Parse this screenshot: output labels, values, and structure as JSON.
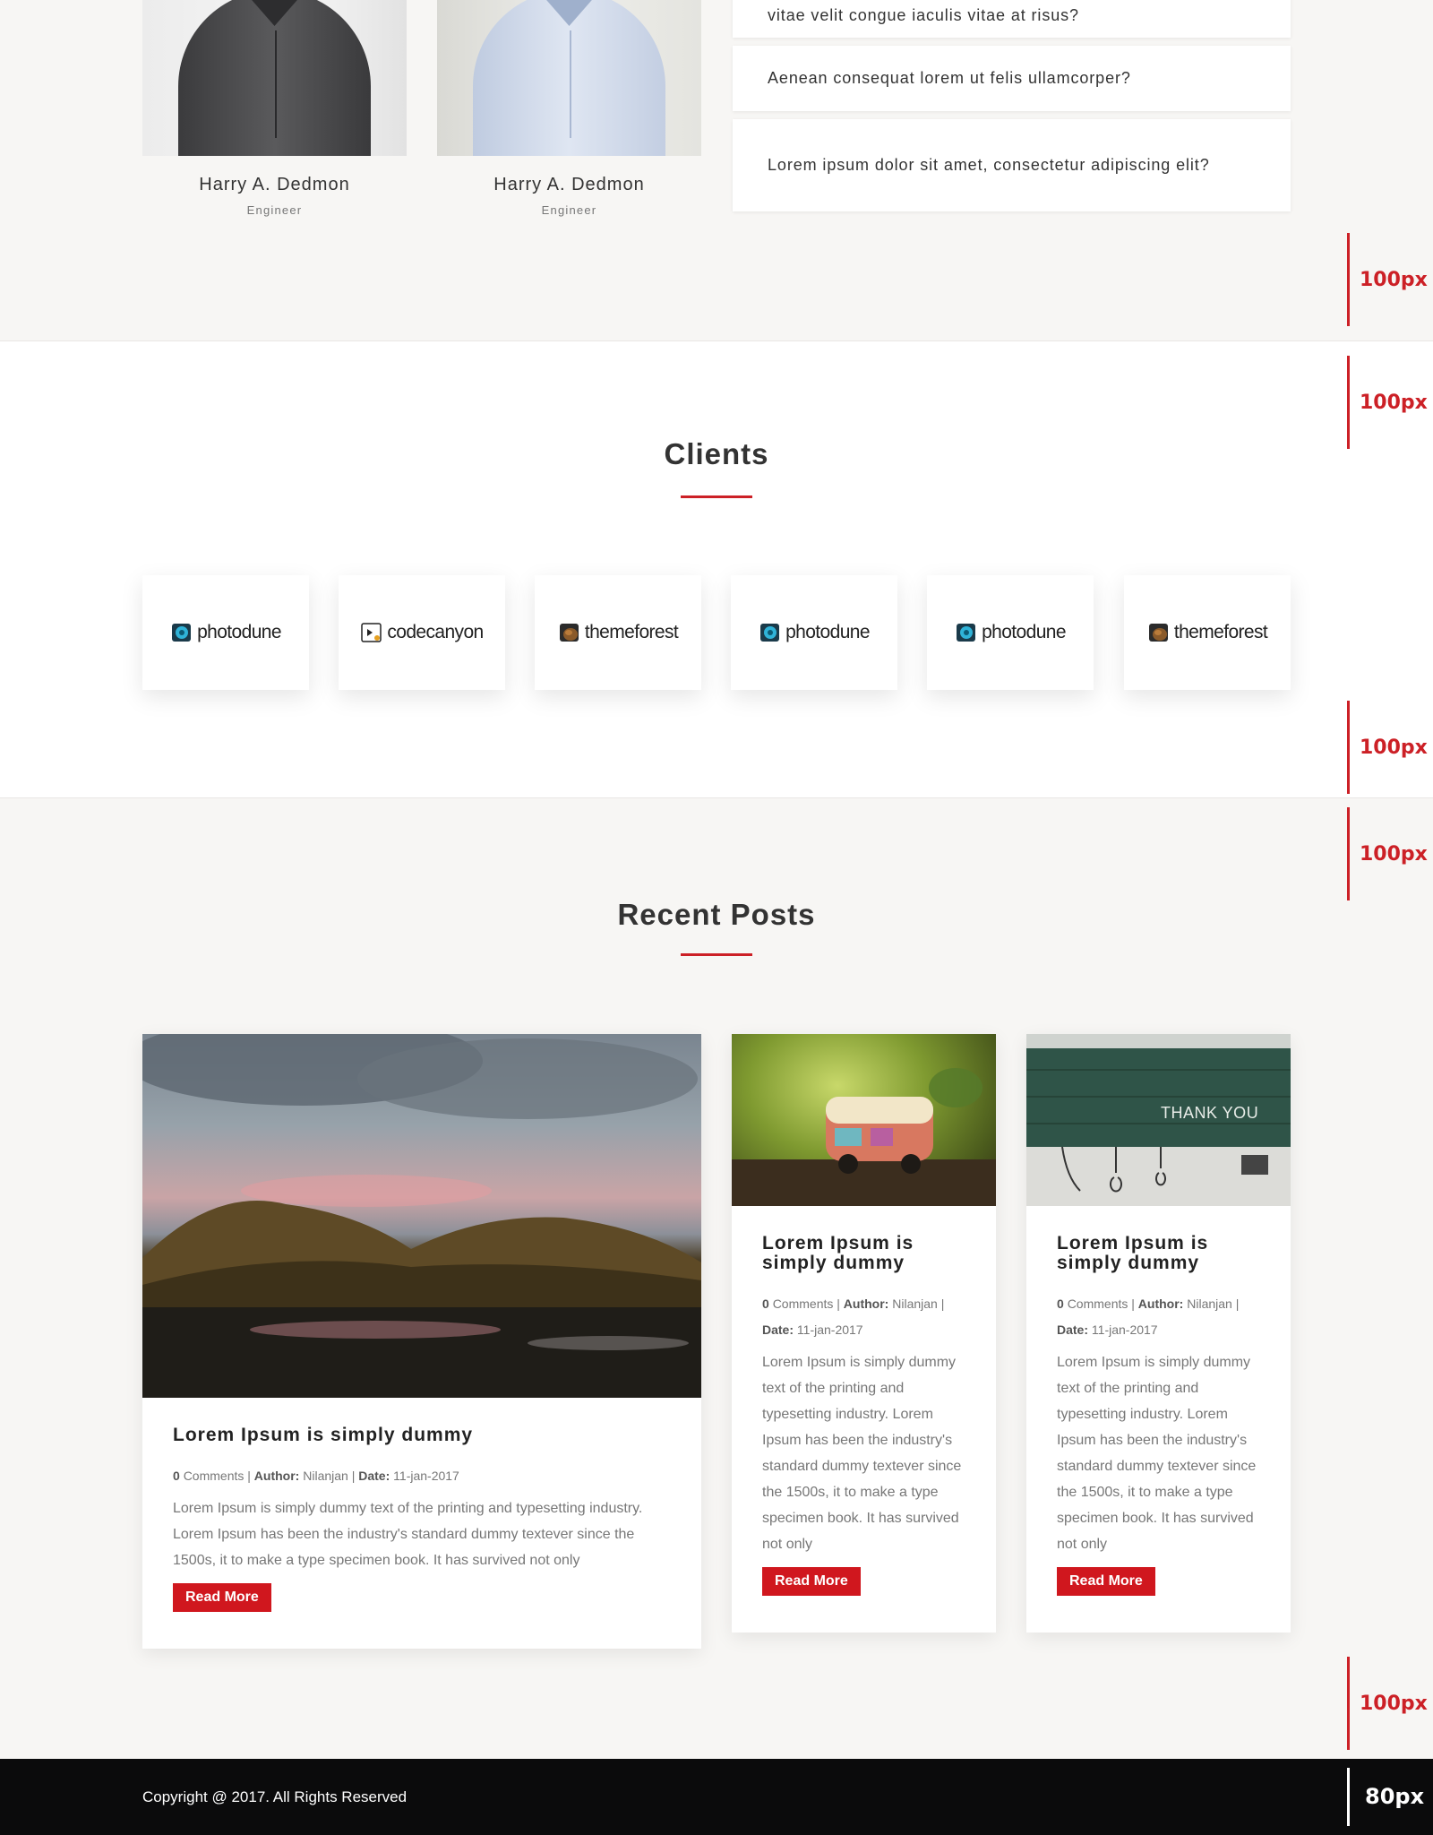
{
  "team": {
    "members": [
      {
        "name": "Harry A. Dedmon",
        "role": "Engineer"
      },
      {
        "name": "Harry A. Dedmon",
        "role": "Engineer"
      }
    ]
  },
  "faq": {
    "items": [
      "vitae velit congue iaculis vitae at risus?",
      "Aenean consequat lorem ut felis ullamcorper?",
      "Lorem ipsum dolor sit amet, consectetur adipiscing elit?"
    ]
  },
  "spacing_markers": [
    "100px",
    "100px",
    "100px",
    "100px",
    "100px",
    "80px"
  ],
  "clients": {
    "title": "Clients",
    "logos": [
      {
        "text": "photodune",
        "icon": "photodune-logo-icon"
      },
      {
        "text": "codecanyon",
        "icon": "codecanyon-logo-icon"
      },
      {
        "text": "themeforest",
        "icon": "themeforest-logo-icon"
      },
      {
        "text": "photodune",
        "icon": "photodune-logo-icon"
      },
      {
        "text": "photodune",
        "icon": "photodune-logo-icon"
      },
      {
        "text": "themeforest",
        "icon": "themeforest-logo-icon"
      }
    ]
  },
  "recent_posts": {
    "title": "Recent Posts",
    "meta_labels": {
      "comments": "Comments",
      "author": "Author:",
      "date": "Date:",
      "separator": "|"
    },
    "posts": [
      {
        "image": "landscape-photo",
        "title": "Lorem Ipsum is simply dummy",
        "comments": "0",
        "author": "Nilanjan",
        "date": "11-jan-2017",
        "excerpt": "Lorem Ipsum is simply dummy text of the printing and typesetting industry. Lorem Ipsum has been the industry's standard dummy textever since the 1500s, it to make a type specimen book. It has survived not only",
        "button": "Read More"
      },
      {
        "image": "toy-van-photo",
        "title": "Lorem Ipsum is simply dummy",
        "comments": "0",
        "author": "Nilanjan",
        "date": "11-jan-2017",
        "excerpt": "Lorem Ipsum is simply dummy text of the printing and typesetting industry. Lorem Ipsum has been the industry's standard dummy textever since the 1500s, it to make a type specimen book. It has survived not only",
        "button": "Read More"
      },
      {
        "image": "thank-you-photo",
        "image_text": "THANK YOU",
        "title": "Lorem Ipsum is simply dummy",
        "comments": "0",
        "author": "Nilanjan",
        "date": "11-jan-2017",
        "excerpt": "Lorem Ipsum is simply dummy text of the printing and typesetting industry. Lorem Ipsum has been the industry's standard dummy textever since the 1500s, it to make a type specimen book. It has survived not only",
        "button": "Read More"
      }
    ]
  },
  "footer": {
    "copyright": "Copyright @ 2017. All Rights Reserved"
  },
  "colors": {
    "accent": "#cc2026",
    "button": "#d0171e",
    "section_bg": "#f7f6f4",
    "footer_bg": "#0b0b0c"
  }
}
